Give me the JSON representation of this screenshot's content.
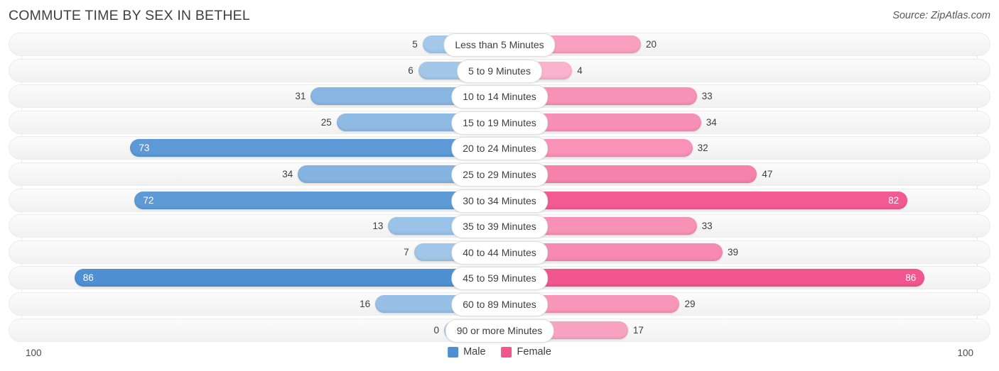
{
  "header": {
    "title": "COMMUTE TIME BY SEX IN BETHEL",
    "source": "Source: ZipAtlas.com"
  },
  "legend": {
    "male_label": "Male",
    "female_label": "Female",
    "male_color": "#4e90d2",
    "female_color": "#f2568f"
  },
  "axis": {
    "left_max": "100",
    "right_max": "100"
  },
  "chart_data": {
    "type": "bar",
    "subtype": "diverging-bar",
    "title": "COMMUTE TIME BY SEX IN BETHEL",
    "xlabel": "",
    "ylabel": "",
    "xlim": [
      100,
      100
    ],
    "grid": true,
    "legend_position": "bottom-center",
    "categories": [
      "Less than 5 Minutes",
      "5 to 9 Minutes",
      "10 to 14 Minutes",
      "15 to 19 Minutes",
      "20 to 24 Minutes",
      "25 to 29 Minutes",
      "30 to 34 Minutes",
      "35 to 39 Minutes",
      "40 to 44 Minutes",
      "45 to 59 Minutes",
      "60 to 89 Minutes",
      "90 or more Minutes"
    ],
    "series": [
      {
        "name": "Male",
        "side": "left",
        "color": "#4e90d2",
        "values": [
          5,
          6,
          31,
          25,
          73,
          34,
          72,
          13,
          7,
          86,
          16,
          0
        ]
      },
      {
        "name": "Female",
        "side": "right",
        "color": "#f2568f",
        "values": [
          20,
          4,
          33,
          34,
          32,
          47,
          82,
          33,
          39,
          86,
          29,
          17
        ]
      }
    ]
  },
  "rows": [
    {
      "label": "Less than 5 Minutes",
      "male": "5",
      "female": "20"
    },
    {
      "label": "5 to 9 Minutes",
      "male": "6",
      "female": "4"
    },
    {
      "label": "10 to 14 Minutes",
      "male": "31",
      "female": "33"
    },
    {
      "label": "15 to 19 Minutes",
      "male": "25",
      "female": "34"
    },
    {
      "label": "20 to 24 Minutes",
      "male": "73",
      "female": "32"
    },
    {
      "label": "25 to 29 Minutes",
      "male": "34",
      "female": "47"
    },
    {
      "label": "30 to 34 Minutes",
      "male": "72",
      "female": "82"
    },
    {
      "label": "35 to 39 Minutes",
      "male": "13",
      "female": "33"
    },
    {
      "label": "40 to 44 Minutes",
      "male": "7",
      "female": "39"
    },
    {
      "label": "45 to 59 Minutes",
      "male": "86",
      "female": "86"
    },
    {
      "label": "60 to 89 Minutes",
      "male": "16",
      "female": "29"
    },
    {
      "label": "90 or more Minutes",
      "male": "0",
      "female": "17"
    }
  ]
}
